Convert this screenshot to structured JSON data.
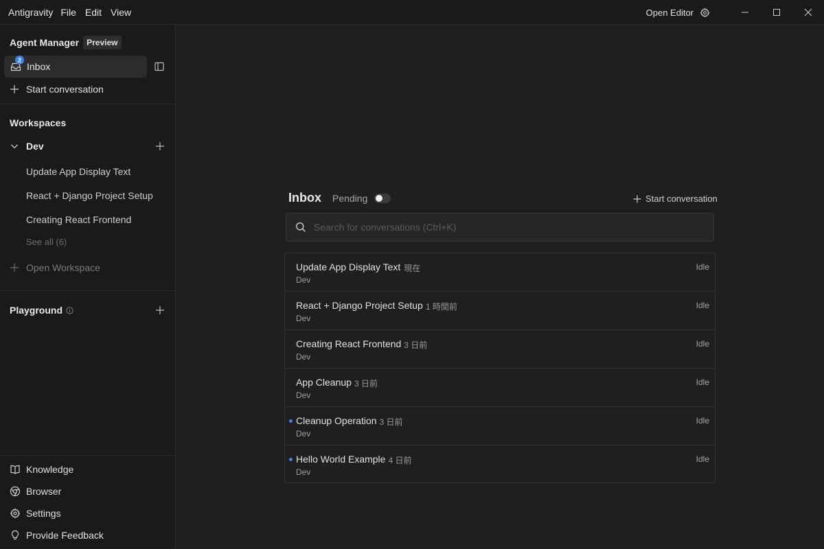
{
  "window": {
    "app_name": "Antigravity",
    "menu": [
      "File",
      "Edit",
      "View"
    ],
    "open_editor": "Open Editor"
  },
  "sidebar": {
    "title": "Agent Manager",
    "badge": "Preview",
    "inbox": {
      "label": "Inbox",
      "count": "2"
    },
    "start_conversation": "Start conversation",
    "workspaces_title": "Workspaces",
    "workspace": {
      "name": "Dev",
      "items": [
        "Update App Display Text",
        "React + Django Project Setup",
        "Creating React Frontend"
      ],
      "see_all": "See all (6)"
    },
    "open_workspace": "Open Workspace",
    "playground": "Playground",
    "bottom": [
      "Knowledge",
      "Browser",
      "Settings",
      "Provide Feedback"
    ]
  },
  "main": {
    "title": "Inbox",
    "pending_label": "Pending",
    "pending_on": false,
    "start_conversation": "Start conversation",
    "search_placeholder": "Search for conversations (Ctrl+K)",
    "conversations": [
      {
        "title": "Update App Display Text",
        "time": "現在",
        "workspace": "Dev",
        "status": "Idle",
        "unread": false
      },
      {
        "title": "React + Django Project Setup",
        "time": "1 時間前",
        "workspace": "Dev",
        "status": "Idle",
        "unread": false
      },
      {
        "title": "Creating React Frontend",
        "time": "3 日前",
        "workspace": "Dev",
        "status": "Idle",
        "unread": false
      },
      {
        "title": "App Cleanup",
        "time": "3 日前",
        "workspace": "Dev",
        "status": "Idle",
        "unread": false
      },
      {
        "title": "Cleanup Operation",
        "time": "3 日前",
        "workspace": "Dev",
        "status": "Idle",
        "unread": true
      },
      {
        "title": "Hello World Example",
        "time": "4 日前",
        "workspace": "Dev",
        "status": "Idle",
        "unread": true
      }
    ]
  },
  "colors": {
    "background": "#1f1f1f",
    "sidebar": "#1a1a1a",
    "accent": "#3b82f6"
  }
}
